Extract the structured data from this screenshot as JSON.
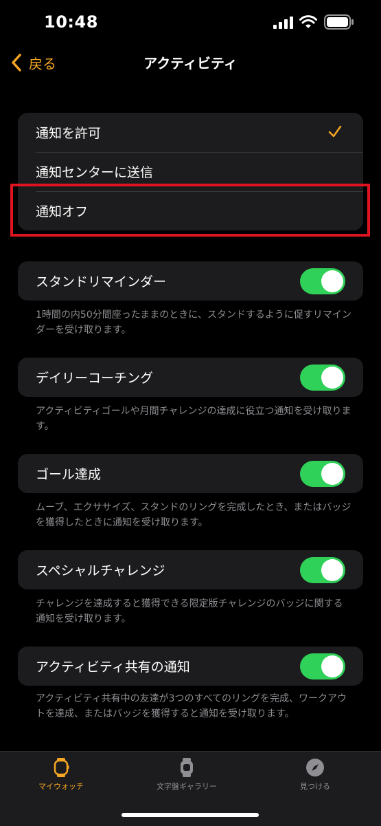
{
  "status": {
    "time": "10:48"
  },
  "nav": {
    "back_label": "戻る",
    "title": "アクティビティ"
  },
  "notify": {
    "options": [
      "通知を許可",
      "通知センターに送信",
      "通知オフ"
    ],
    "selected": "通知を許可"
  },
  "toggles": [
    {
      "label": "スタンドリマインダー",
      "on": true,
      "note": "1時間の内50分間座ったままのときに、スタンドするように促すリマインダーを受け取ります。"
    },
    {
      "label": "デイリーコーチング",
      "on": true,
      "note": "アクティビティゴールや月間チャレンジの達成に役立つ通知を受け取ります。"
    },
    {
      "label": "ゴール達成",
      "on": true,
      "note": "ムーブ、エクササイズ、スタンドのリングを完成したとき、またはバッジを獲得したときに通知を受け取ります。"
    },
    {
      "label": "スペシャルチャレンジ",
      "on": true,
      "note": "チャレンジを達成すると獲得できる限定版チャレンジのバッジに関する通知を受け取ります。"
    },
    {
      "label": "アクティビティ共有の通知",
      "on": true,
      "note": "アクティビティ共有中の友達が3つのすべてのリングを完成、ワークアウトを達成、またはバッジを獲得すると通知を受け取ります。"
    }
  ],
  "tabs": [
    {
      "label": "マイウォッチ",
      "active": true
    },
    {
      "label": "文字盤ギャラリー",
      "active": false
    },
    {
      "label": "見つける",
      "active": false
    }
  ],
  "colors": {
    "accent": "#f5a623",
    "toggle_on": "#30d158",
    "highlight": "#e0141e"
  }
}
